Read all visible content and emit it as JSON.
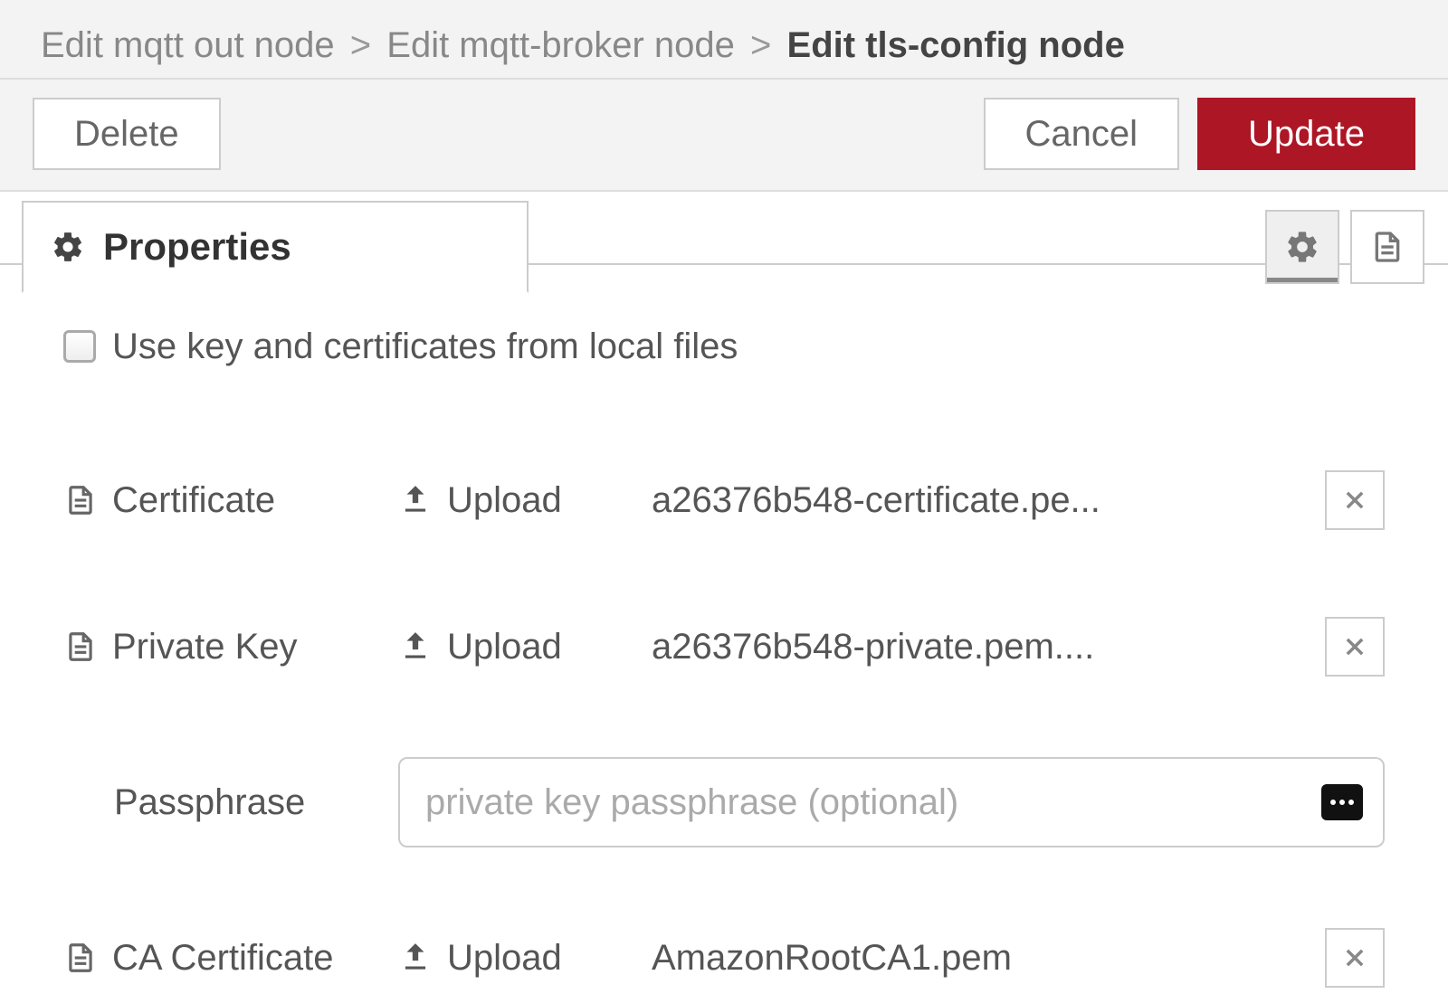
{
  "breadcrumb": {
    "items": [
      "Edit mqtt out node",
      "Edit mqtt-broker node",
      "Edit tls-config node"
    ],
    "separator": ">"
  },
  "toolbar": {
    "delete_label": "Delete",
    "cancel_label": "Cancel",
    "update_label": "Update"
  },
  "tabs": {
    "properties_label": "Properties"
  },
  "form": {
    "use_local_files_label": "Use key and certificates from local files",
    "upload_label": "Upload",
    "certificate": {
      "label": "Certificate",
      "filename": "a26376b548-certificate.pe..."
    },
    "private_key": {
      "label": "Private Key",
      "filename": "a26376b548-private.pem...."
    },
    "passphrase": {
      "label": "Passphrase",
      "placeholder": "private key passphrase (optional)",
      "value": ""
    },
    "ca_certificate": {
      "label": "CA Certificate",
      "filename": "AmazonRootCA1.pem"
    }
  },
  "colors": {
    "primary": "#ad1625"
  }
}
